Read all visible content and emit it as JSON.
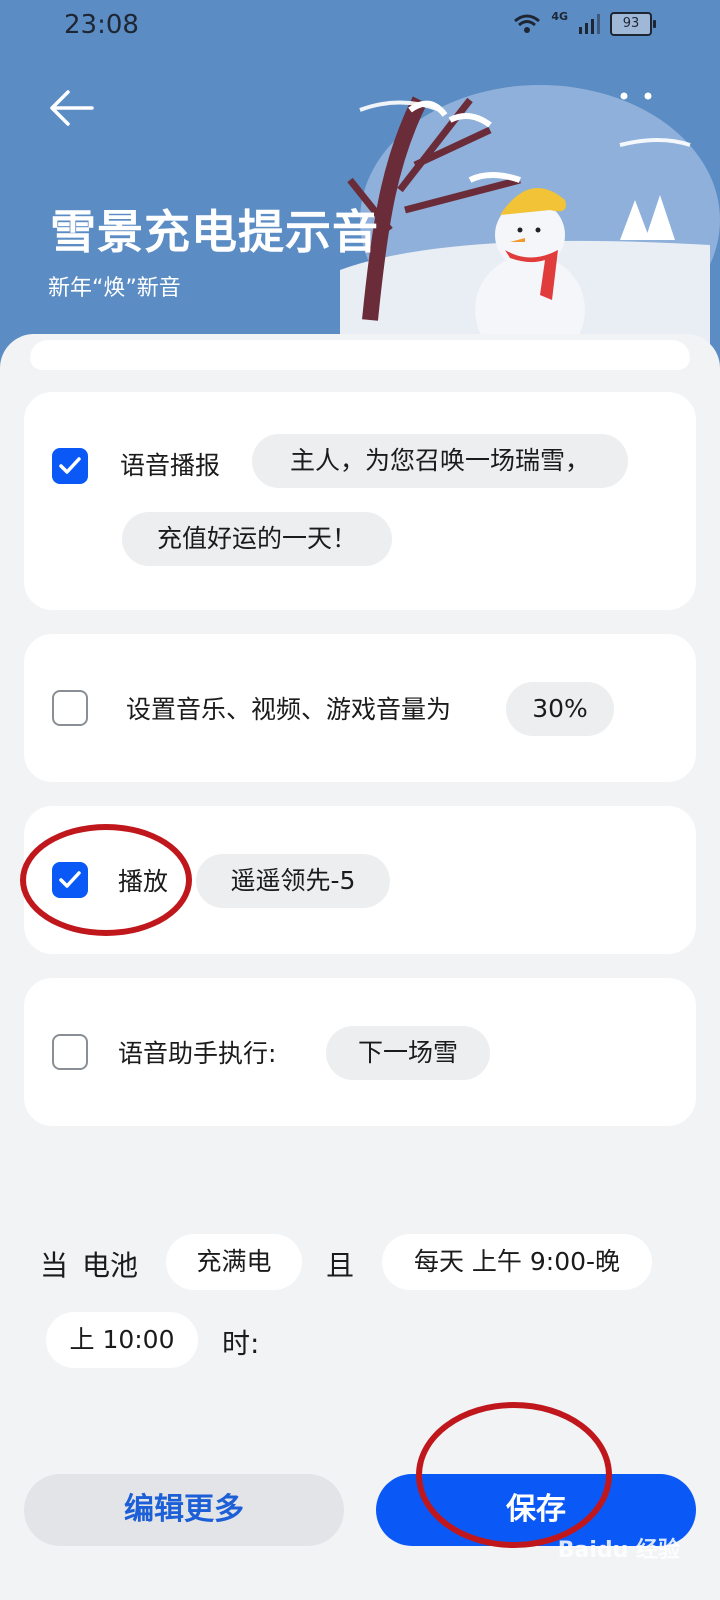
{
  "status": {
    "time": "23:08",
    "network": "4G",
    "battery": "93"
  },
  "header": {
    "title": "雪景充电提示音",
    "subtitle": "新年“焕”新音"
  },
  "actions": [
    {
      "checked": true,
      "label": "语音播报",
      "value_line1": "主人，为您召唤一场瑞雪，",
      "value_line2": "充值好运的一天！"
    },
    {
      "checked": false,
      "label": "设置音乐、视频、游戏音量为",
      "value": "30%"
    },
    {
      "checked": true,
      "label": "播放",
      "value": "遥遥领先-5"
    },
    {
      "checked": false,
      "label": "语音助手执行:",
      "value": "下一场雪"
    }
  ],
  "condition": {
    "when": "当",
    "battery": "电池",
    "battery_state": "充满电",
    "and": "且",
    "time_range_a": "每天 上午 9:00-晚",
    "time_range_b": "上 10:00",
    "suffix": "时:"
  },
  "buttons": {
    "edit": "编辑更多",
    "save": "保存"
  },
  "watermark": "Baidu 经验",
  "colors": {
    "accent": "#0a59f7",
    "header": "#5b8cc4",
    "annotation": "#c0171d"
  }
}
